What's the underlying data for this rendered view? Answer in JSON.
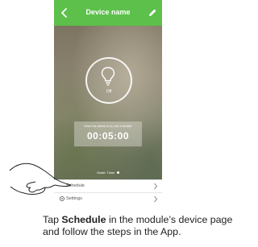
{
  "app": {
    "title": "Device name"
  },
  "device": {
    "state": "Off",
    "timer_caption": "When the device is on, turn it off after",
    "timer_value": "00:05:00",
    "mode_label": "Mode: Timer"
  },
  "menu": [
    {
      "label": "Schedule",
      "icon": "chevron-right-icon"
    },
    {
      "label": "Settings",
      "icon": "gear-icon"
    }
  ],
  "instruction": {
    "prefix": "Tap ",
    "bold": "Schedule",
    "suffix": " in the module’s device page",
    "line2": "and follow the steps in the App."
  },
  "colors": {
    "header": "#5cc04a",
    "text": "#222222"
  }
}
